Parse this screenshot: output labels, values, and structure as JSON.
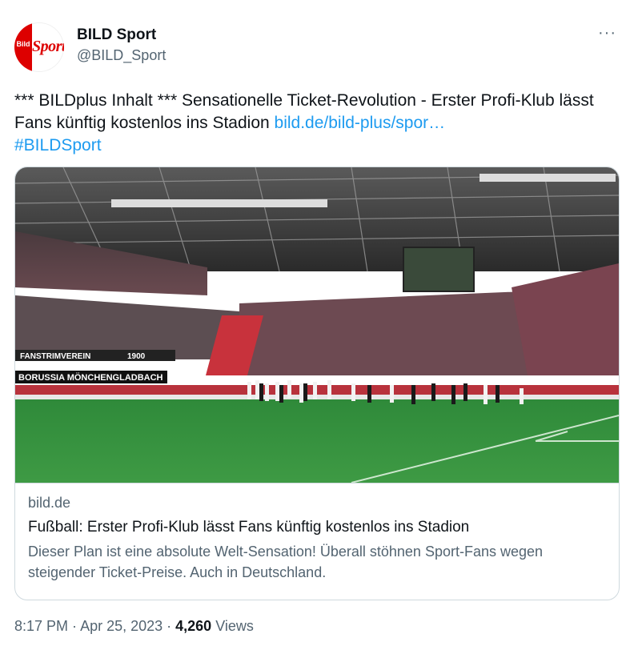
{
  "author": {
    "name": "BILD Sport",
    "handle": "@BILD_Sport",
    "avatar_text_top": "Bild",
    "avatar_text_main": "Sport",
    "more_icon": "···"
  },
  "tweet": {
    "text_before": "*** BILDplus Inhalt *** Sensationelle Ticket-Revolution - Erster Profi-Klub lässt Fans künftig kostenlos ins Stadion ",
    "link": "bild.de/bild-plus/spor…",
    "hashtag": "#BILDSport"
  },
  "card": {
    "domain": "bild.de",
    "title": "Fußball: Erster Profi-Klub lässt Fans künftig kostenlos ins Stadion",
    "description": "Dieser Plan ist eine absolute Welt-Sensation! Überall stöhnen Sport-Fans wegen steigender Ticket-Preise. Auch in Deutschland.",
    "image_banner_1": "BORUSSIA MÖNCHENGLADBACH",
    "image_banner_2": "FANSTRIMVEREIN",
    "image_banner_3": "1900"
  },
  "meta": {
    "time": "8:17 PM",
    "date": "Apr 25, 2023",
    "sep": " · ",
    "views_count": "4,260",
    "views_label": "Views"
  },
  "colors": {
    "link": "#1d9bf0",
    "text": "#0f1419",
    "muted": "#536471",
    "border": "#cfd9de",
    "brand_red": "#dd0000"
  }
}
